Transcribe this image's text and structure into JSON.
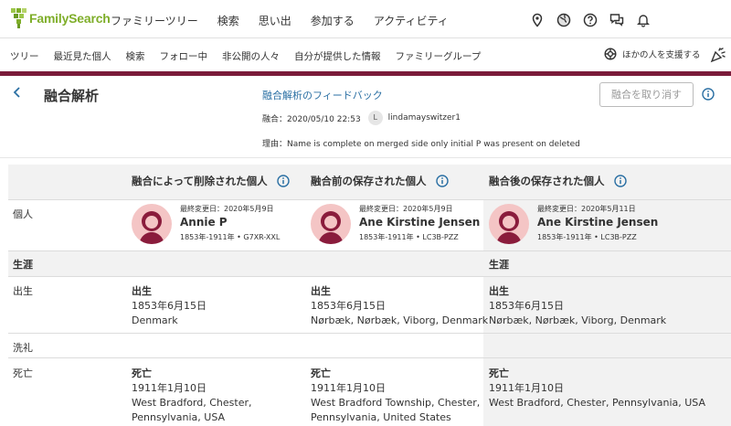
{
  "brand": {
    "name": "FamilySearch"
  },
  "main_menu": [
    "ファミリーツリー",
    "検索",
    "思い出",
    "参加する",
    "アクティビティ"
  ],
  "top_icons": [
    "location-pin-icon",
    "globe-icon",
    "help-icon",
    "messages-icon",
    "bell-icon"
  ],
  "sub_menu": [
    "ツリー",
    "最近見た個人",
    "検索",
    "フォロー中",
    "非公開の人々",
    "自分が提供した情報",
    "ファミリーグループ"
  ],
  "help_others": "ほかの人を支援する",
  "header": {
    "title": "融合解析",
    "feedback_link": "融合解析のフィードバック",
    "merge_label": "融合：2020/05/10 22:53",
    "user_initial": "L",
    "user_name": "lindamayswitzer1",
    "reason": "理由：Name is complete on merged side only initial P was present on deleted",
    "undo_button": "融合を取り消す"
  },
  "columns": [
    "融合によって削除された個人",
    "融合前の保存された個人",
    "融合後の保存された個人"
  ],
  "row_labels": {
    "person": "個人",
    "vitals": "生涯",
    "birth": "出生",
    "christening": "洗礼",
    "death": "死亡"
  },
  "persons": [
    {
      "modified": "最終変更日：2020年5月9日",
      "name": "Annie P",
      "dates": "1853年-1911年 • G7XR-XXL"
    },
    {
      "modified": "最終変更日：2020年5月9日",
      "name": "Ane Kirstine Jensen",
      "dates": "1853年-1911年 • LC3B-PZZ"
    },
    {
      "modified": "最終変更日：2020年5月11日",
      "name": "Ane Kirstine Jensen",
      "dates": "1853年-1911年 • LC3B-PZZ"
    }
  ],
  "vitals_headers": [
    "生涯",
    "生涯"
  ],
  "births": [
    {
      "title": "出生",
      "date": "1853年6月15日",
      "place": "Denmark"
    },
    {
      "title": "出生",
      "date": "1853年6月15日",
      "place": "Nørbæk, Nørbæk, Viborg, Denmark"
    },
    {
      "title": "出生",
      "date": "1853年6月15日",
      "place": "Nørbæk, Nørbæk, Viborg, Denmark"
    }
  ],
  "deaths": [
    {
      "title": "死亡",
      "date": "1911年1月10日",
      "place1": "West Bradford, Chester,",
      "place2": "Pennsylvania, USA"
    },
    {
      "title": "死亡",
      "date": "1911年1月10日",
      "place1": "West Bradford Township, Chester,",
      "place2": "Pennsylvania, United States"
    },
    {
      "title": "死亡",
      "date": "1911年1月10日",
      "place1": "West Bradford, Chester, Pennsylvania, USA",
      "place2": ""
    }
  ],
  "colors": {
    "brand_green": "#7fae2a",
    "link_blue": "#2a6fa3",
    "accent_maroon": "#7a1b3a",
    "avatar_pink": "#f4c5c5",
    "avatar_dark": "#8a1c3c"
  }
}
